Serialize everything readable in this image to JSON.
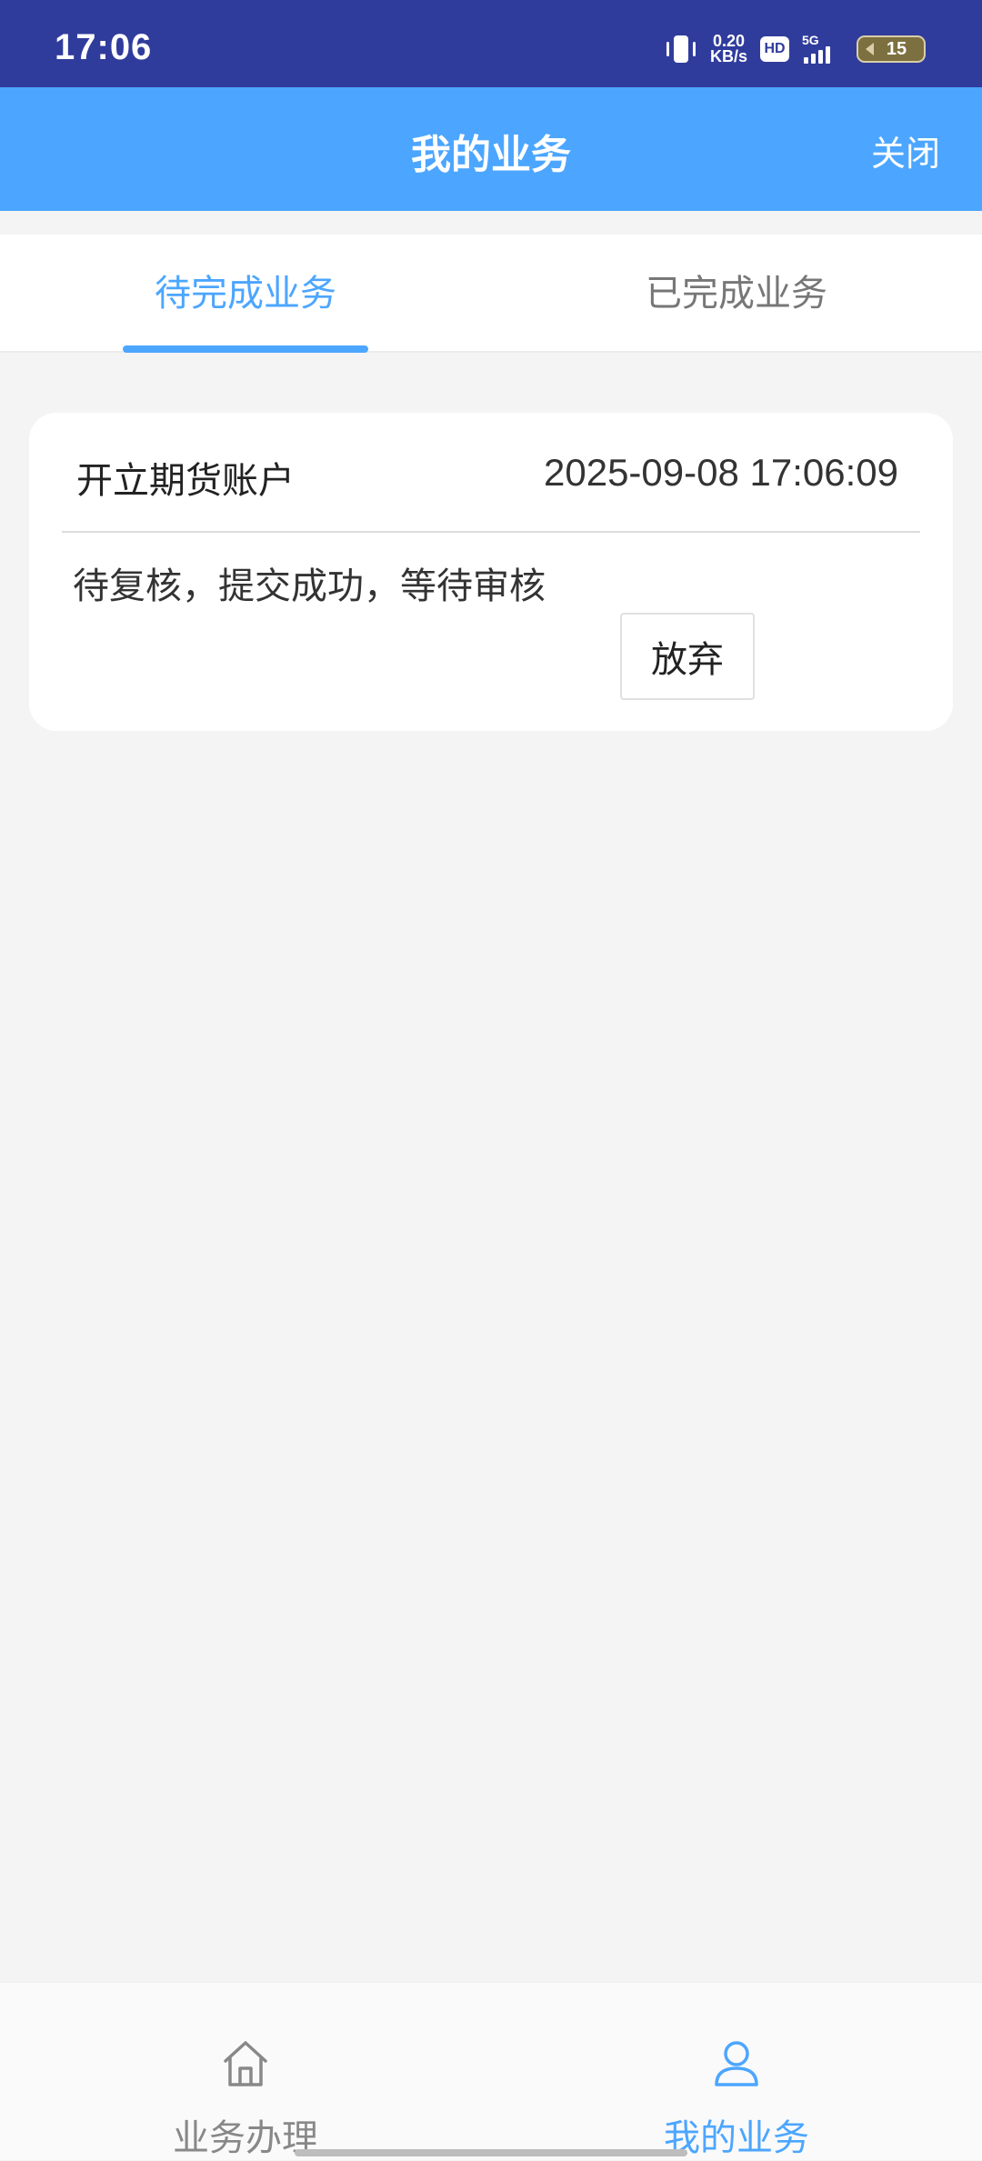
{
  "status_bar": {
    "time": "17:06",
    "net_speed_value": "0.20",
    "net_speed_unit": "KB/s",
    "hd_label": "HD",
    "network_type": "5G",
    "battery_level": "15"
  },
  "header": {
    "title": "我的业务",
    "close_label": "关闭"
  },
  "tabs": [
    {
      "label": "待完成业务",
      "active": true
    },
    {
      "label": "已完成业务",
      "active": false
    }
  ],
  "business_items": [
    {
      "name": "开立期货账户",
      "time": "2025-09-08 17:06:09",
      "status": "待复核，提交成功，等待审核",
      "action_label": "放弃"
    }
  ],
  "bottom_nav": [
    {
      "label": "业务办理",
      "icon": "home-icon",
      "active": false
    },
    {
      "label": "我的业务",
      "icon": "user-icon",
      "active": true
    }
  ],
  "colors": {
    "status_bar_bg": "#303c9c",
    "accent": "#4ca6ff",
    "page_bg": "#f4f4f4",
    "inactive_text": "#888888"
  }
}
